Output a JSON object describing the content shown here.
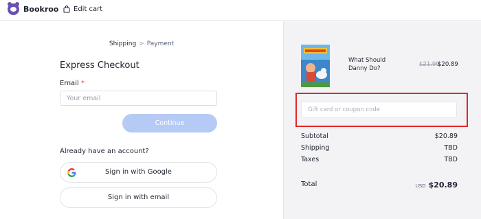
{
  "header": {
    "brand": "Bookroo",
    "edit_cart": "Edit cart"
  },
  "steps": {
    "current": "Shipping",
    "separator": ">",
    "next": "Payment"
  },
  "checkout": {
    "title": "Express Checkout",
    "email_label": "Email",
    "email_required_mark": "*",
    "email_placeholder": "Your email",
    "continue_label": "Continue",
    "account_prompt": "Already have an account?",
    "google_label": "Sign in with Google",
    "email_signin_label": "Sign in with email"
  },
  "cart": {
    "item": {
      "title": "What Should Danny Do?",
      "price_original": "$21.99",
      "price_current": "$20.89"
    },
    "coupon_placeholder": "Gift card or coupon code",
    "summary": {
      "subtotal_label": "Subtotal",
      "subtotal_value": "$20.89",
      "shipping_label": "Shipping",
      "shipping_value": "TBD",
      "taxes_label": "Taxes",
      "taxes_value": "TBD",
      "total_label": "Total",
      "total_currency": "USD",
      "total_value": "$20.89"
    }
  },
  "colors": {
    "brand": "#6b4fb3",
    "continue_button": "#b5cbf6",
    "highlight": "#e32626",
    "right_panel_bg": "#f3f3f6"
  }
}
